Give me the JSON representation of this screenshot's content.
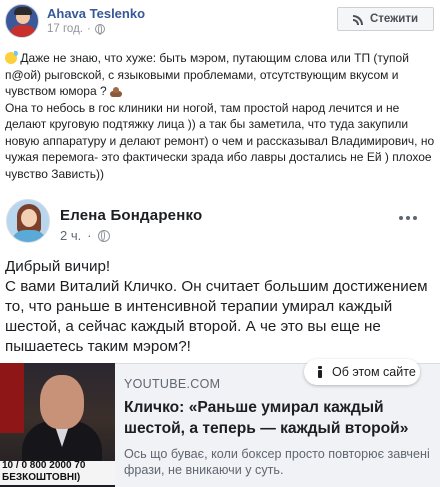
{
  "outer_post": {
    "author": "Ahava Teslenko",
    "time": "17 год.",
    "follow_label": "Стежити",
    "paragraph_1": "Даже не знаю, что хуже: быть мэром, путающим слова или ТП (тупой п@ой) рыговской, с языковыми проблемами, отсутствующим вкусом и чувством юмора ?",
    "paragraph_2": "Она то небось в гос клиники ни ногой, там простой народ лечится и не делают круговую подтяжку лица )) а так бы заметила, что туда закупили новую аппаратуру и делают ремонт) о чем и рассказывал Владимирович, но чужая перемога- это фактически зрада ибо лавры достались не Ей ) плохое чувство Зависть))"
  },
  "shared_post": {
    "author": "Елена Бондаренко",
    "time": "2 ч.",
    "text_1": "Дибрый вичир!",
    "text_2": "С вами Виталий Кличко. Он считает большим достижением то, что раньше в интенсивной терапии умирал каждый шестой, а сейчас каждый второй. А че это вы еще не пышаетесь таким мэром?!"
  },
  "link_preview": {
    "info_label": "Об этом сайте",
    "domain": "YOUTUBE.COM",
    "title": "Кличко: «Раньше умирал каждый шестой, а теперь — каждый второй»",
    "description": "Ось що буває, коли боксер просто повторює завчені фрази, не вникаючи у суть.",
    "thumb_text": "10 / 0 800 2000 70",
    "thumb_text_2": "БЕЗКОШТОВНІ)"
  },
  "icons": {
    "outer_avatar": "avatar",
    "globe": "globe-icon",
    "follow": "rss-icon",
    "more": "more-icon",
    "info": "info-icon"
  },
  "colors": {
    "link_blue": "#385898",
    "text": "#1c1e21",
    "meta_gray": "#90949c",
    "preview_bg": "#f0f2f5"
  }
}
